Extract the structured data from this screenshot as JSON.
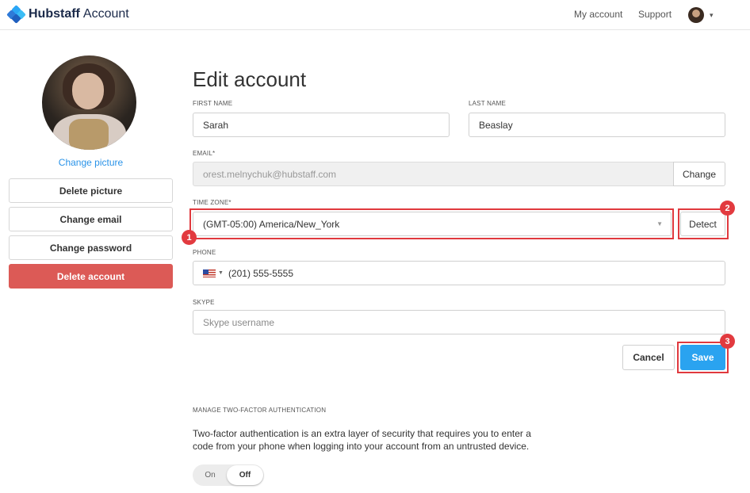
{
  "header": {
    "brand": "Hubstaff",
    "app_name": "Account",
    "nav": {
      "my_account": "My account",
      "support": "Support"
    },
    "avatar_caret": "▾"
  },
  "sidebar": {
    "change_picture": "Change picture",
    "buttons": {
      "delete_picture": "Delete picture",
      "change_email": "Change email",
      "change_password": "Change password",
      "delete_account": "Delete account"
    }
  },
  "form": {
    "title": "Edit account",
    "first_name": {
      "label": "FIRST NAME",
      "value": "Sarah"
    },
    "last_name": {
      "label": "LAST NAME",
      "value": "Beaslay"
    },
    "email": {
      "label": "EMAIL*",
      "value": "orest.melnychuk@hubstaff.com",
      "button": "Change"
    },
    "time_zone": {
      "label": "TIME ZONE*",
      "value": "(GMT-05:00) America/New_York",
      "button": "Detect"
    },
    "phone": {
      "label": "PHONE",
      "value": "(201) 555-5555",
      "country": "US"
    },
    "skype": {
      "label": "SKYPE",
      "placeholder": "Skype username"
    },
    "actions": {
      "cancel": "Cancel",
      "save": "Save"
    }
  },
  "callouts": [
    "1",
    "2",
    "3"
  ],
  "two_factor": {
    "title": "MANAGE TWO-FACTOR AUTHENTICATION",
    "description": "Two-factor authentication is an extra layer of security that requires you to enter a code from your phone when logging into your account from an untrusted device.",
    "on_label": "On",
    "off_label": "Off",
    "state": "Off"
  },
  "colors": {
    "accent": "#2aa3f0",
    "link": "#2a93e8",
    "danger": "#dc5a56",
    "callout": "#e23a3f"
  }
}
